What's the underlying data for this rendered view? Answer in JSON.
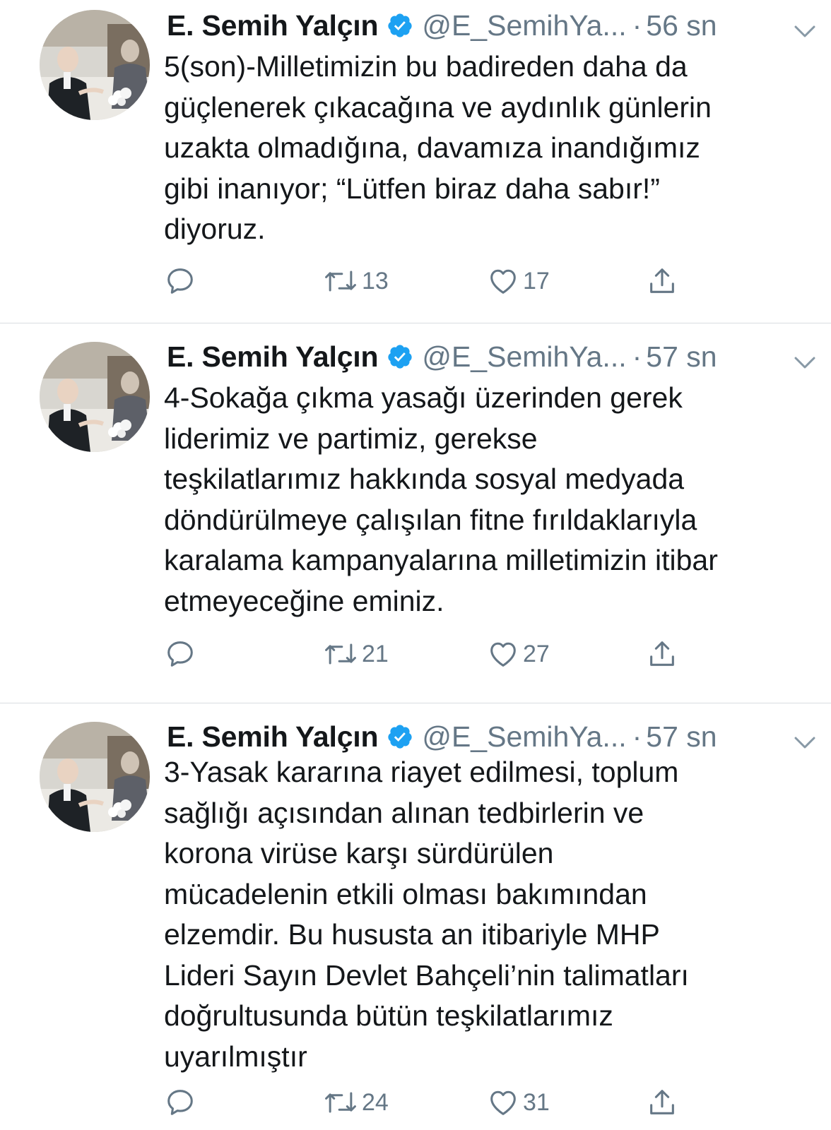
{
  "colors": {
    "text": "#14171a",
    "secondary": "#657786",
    "verified": "#1da1f2",
    "divider": "#d9dde1"
  },
  "tweets": [
    {
      "name": "E. Semih Yalçın",
      "handle": "@E_SemihYa...",
      "separator": "·",
      "time": "56 sn",
      "text": "5(son)-Milletimizin bu badireden daha da\ngüçlenerek çıkacağına ve aydınlık günlerin\nuzakta olmadığına, davamıza inandığımız\ngibi inanıyor; “Lütfen biraz daha sabır!”\ndiyoruz.",
      "retweets": "13",
      "likes": "17"
    },
    {
      "name": "E. Semih Yalçın",
      "handle": "@E_SemihYa...",
      "separator": "·",
      "time": "57 sn",
      "text": "4-Sokağa çıkma yasağı üzerinden gerek\nliderimiz ve partimiz, gerekse\nteşkilatlarımız hakkında sosyal medyada\ndöndürülmeye çalışılan fitne fırıldaklarıyla\nkaralama kampanyalarına milletimizin itibar\netmeyeceğine eminiz.",
      "retweets": "21",
      "likes": "27"
    },
    {
      "name": "E. Semih Yalçın",
      "handle": "@E_SemihYa...",
      "separator": "·",
      "time": "57 sn",
      "text": "3-Yasak kararına riayet edilmesi, toplum\nsağlığı açısından alınan tedbirlerin ve\nkorona virüse karşı sürdürülen\nmücadelenin etkili olması bakımından\nelzemdir. Bu hususta an itibariyle MHP\nLideri Sayın Devlet Bahçeli’nin talimatları\ndoğrultusunda bütün teşkilatlarımız\nuyarılmıştır",
      "retweets": "24",
      "likes": "31"
    }
  ],
  "icons": {
    "avatar": "profile-photo",
    "verified": "verified-badge-icon",
    "caret": "chevron-down-icon",
    "reply": "reply-icon",
    "retweet": "retweet-icon",
    "like": "heart-icon",
    "share": "share-icon"
  }
}
